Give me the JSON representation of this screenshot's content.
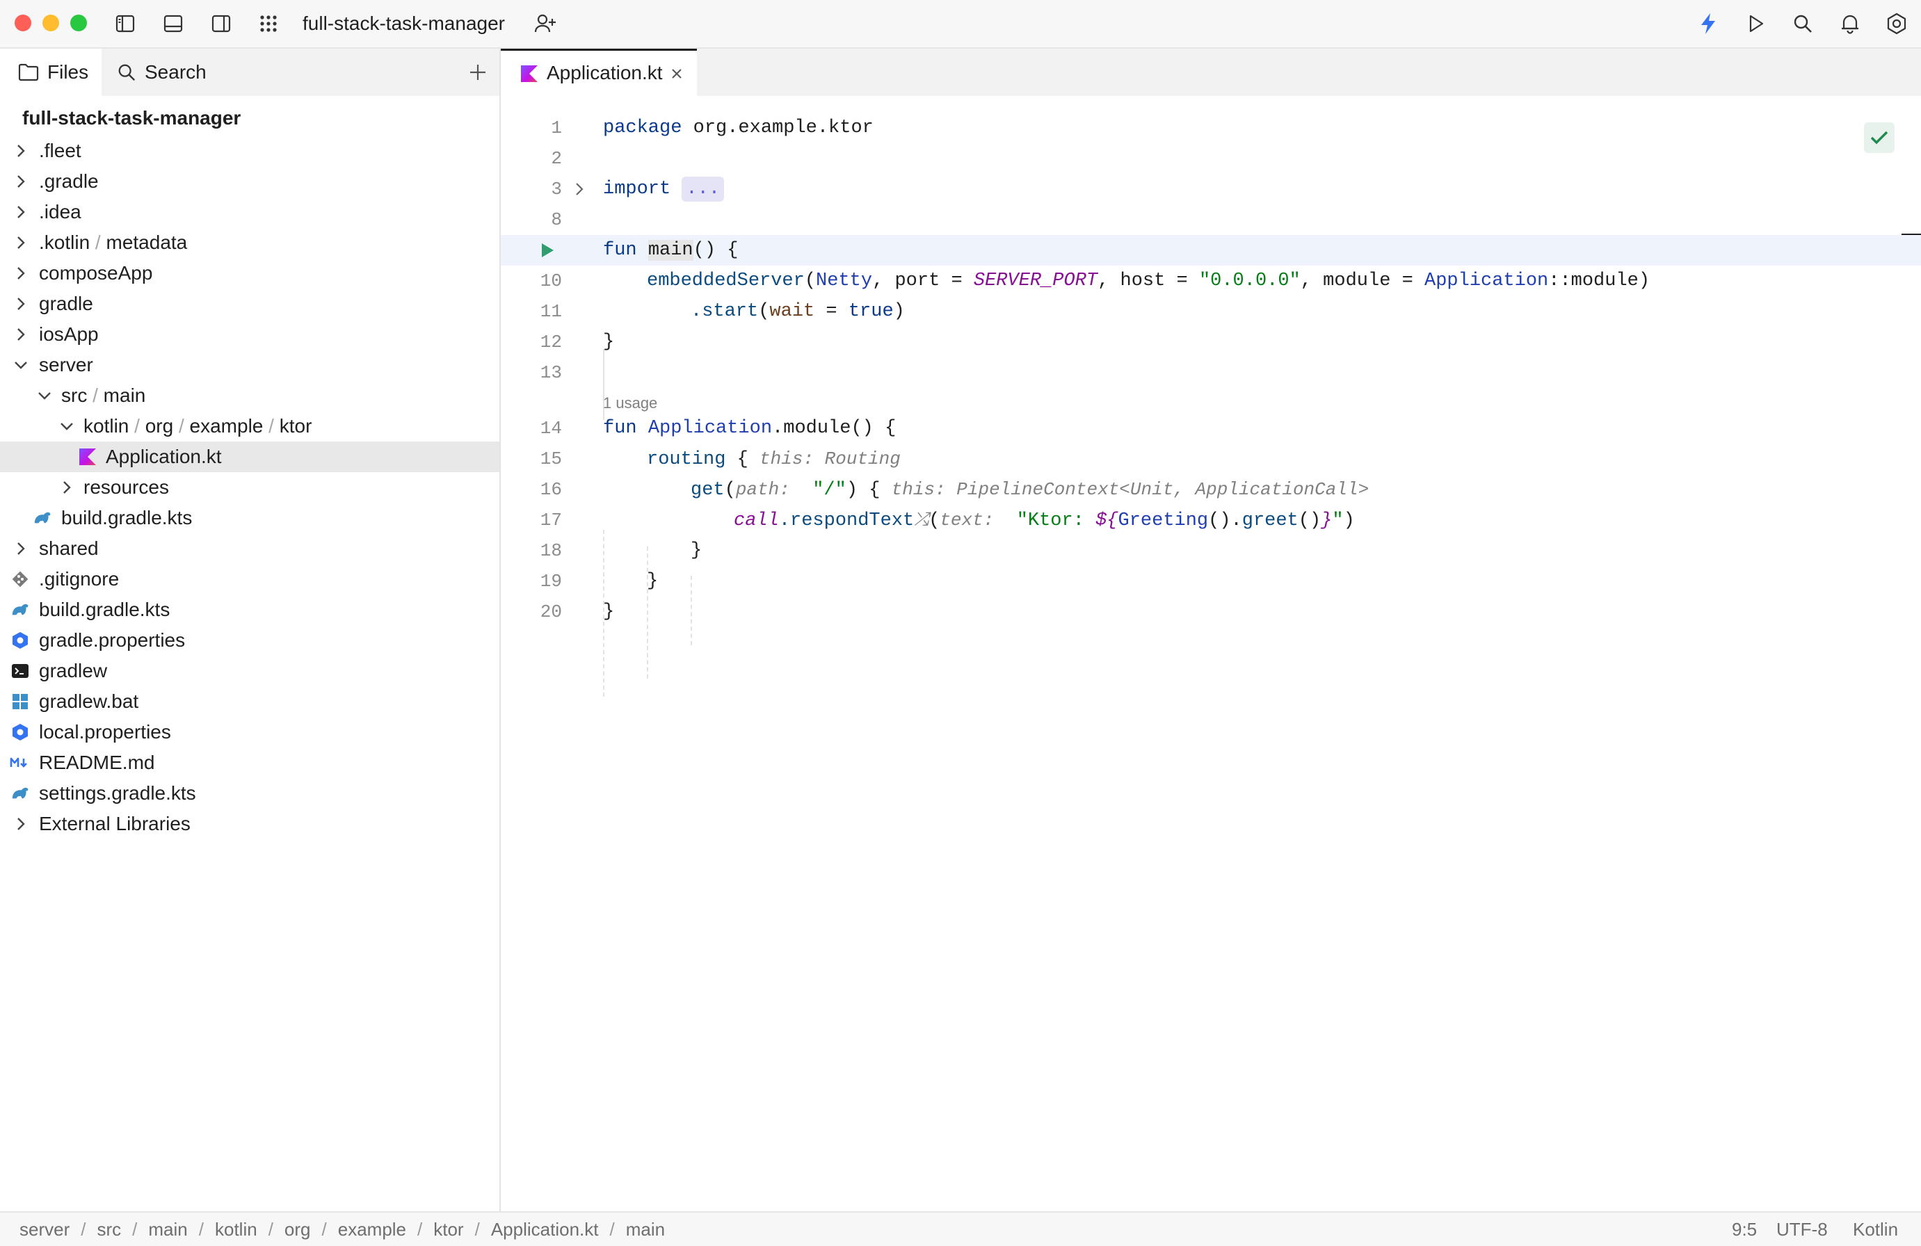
{
  "titlebar": {
    "project_name": "full-stack-task-manager",
    "icons": [
      "sidebar-left-icon",
      "panel-bottom-icon",
      "sidebar-right-icon",
      "apps-grid-icon",
      "add-user-icon",
      "lightning-icon",
      "run-icon",
      "search-icon",
      "bell-icon",
      "settings-icon"
    ],
    "accent": "#3574f0"
  },
  "sidebar": {
    "tabs": [
      {
        "label": "Files",
        "icon": "folder-icon"
      },
      {
        "label": "Search",
        "icon": "search-icon"
      }
    ],
    "root": "full-stack-task-manager",
    "tree": [
      {
        "label": ".fleet",
        "expanded": false
      },
      {
        "label": ".gradle",
        "expanded": false
      },
      {
        "label": ".idea",
        "expanded": false
      },
      {
        "label": ".kotlin",
        "label2": "metadata",
        "expanded": false
      },
      {
        "label": "composeApp",
        "expanded": false
      },
      {
        "label": "gradle",
        "expanded": false
      },
      {
        "label": "iosApp",
        "expanded": false
      },
      {
        "label": "server",
        "expanded": true
      },
      {
        "label": "src",
        "label2": "main",
        "expanded": true
      },
      {
        "label": "kotlin",
        "label2": "org",
        "label3": "example",
        "label4": "ktor",
        "expanded": true
      },
      {
        "label": "Application.kt",
        "selected": true,
        "icon": "kotlin-file-icon"
      },
      {
        "label": "resources",
        "expanded": false
      },
      {
        "label": "build.gradle.kts",
        "icon": "gradle-icon"
      },
      {
        "label": "shared",
        "expanded": false
      },
      {
        "label": ".gitignore",
        "icon": "git-icon"
      },
      {
        "label": "build.gradle.kts",
        "icon": "gradle-icon"
      },
      {
        "label": "gradle.properties",
        "icon": "properties-icon"
      },
      {
        "label": "gradlew",
        "icon": "terminal-icon"
      },
      {
        "label": "gradlew.bat",
        "icon": "windows-icon"
      },
      {
        "label": "local.properties",
        "icon": "properties-icon"
      },
      {
        "label": "README.md",
        "icon": "markdown-icon"
      },
      {
        "label": "settings.gradle.kts",
        "icon": "gradle-icon"
      },
      {
        "label": "External Libraries",
        "expanded": false
      }
    ]
  },
  "editor": {
    "tab_label": "Application.kt",
    "line_numbers": [
      "1",
      "2",
      "3",
      "8",
      "",
      "10",
      "11",
      "12",
      "13",
      "14",
      "15",
      "16",
      "17",
      "18",
      "19",
      "20"
    ],
    "usage_hint": "1 usage",
    "code": {
      "l1_kw": "package",
      "l1_rest": " org.example.ktor",
      "l3_kw": "import",
      "l3_fold": "...",
      "l9_kw": "fun",
      "l9_name": "main",
      "l9_rest": "() {",
      "l10_fn": "embeddedServer",
      "l10_p1": "(",
      "l10_netty": "Netty",
      "l10_p2": ", port = ",
      "l10_const": "SERVER_PORT",
      "l10_p3": ", host = ",
      "l10_str": "\"0.0.0.0\"",
      "l10_p4": ", module = ",
      "l10_app": "Application",
      "l10_p5": "::module)",
      "l11_a": ".start",
      "l11_b": "(",
      "l11_param": "wait",
      "l11_c": " = ",
      "l11_true": "true",
      "l11_d": ")",
      "l12": "}",
      "l14_kw": "fun",
      "l14_cls": "Application",
      "l14_rest": ".module() {",
      "l15_fn": "routing",
      "l15_brace": " {",
      "l15_hint": "this: Routing",
      "l16_fn": "get",
      "l16_p": "(",
      "l16_hint": "path:",
      "l16_str": "\"/\"",
      "l16_rest": ") {",
      "l16_hint2": "this: PipelineContext<Unit, ApplicationCall>",
      "l17_call": "call",
      "l17_fn": ".respondText",
      "l17_p": "(",
      "l17_hint": "text:",
      "l17_str1": "\"Ktor: ",
      "l17_tpl": "${",
      "l17_greet": "Greeting",
      "l17_mid": "().",
      "l17_greetfn": "greet",
      "l17_end": "()",
      "l17_tpl2": "}",
      "l17_str2": "\"",
      "l17_close": ")",
      "l18": "}",
      "l19": "}",
      "l20": "}"
    }
  },
  "statusbar": {
    "breadcrumb": [
      "server",
      "src",
      "main",
      "kotlin",
      "org",
      "example",
      "ktor",
      "Application.kt",
      "main"
    ],
    "position": "9:5",
    "encoding": "UTF-8",
    "language": "Kotlin"
  }
}
